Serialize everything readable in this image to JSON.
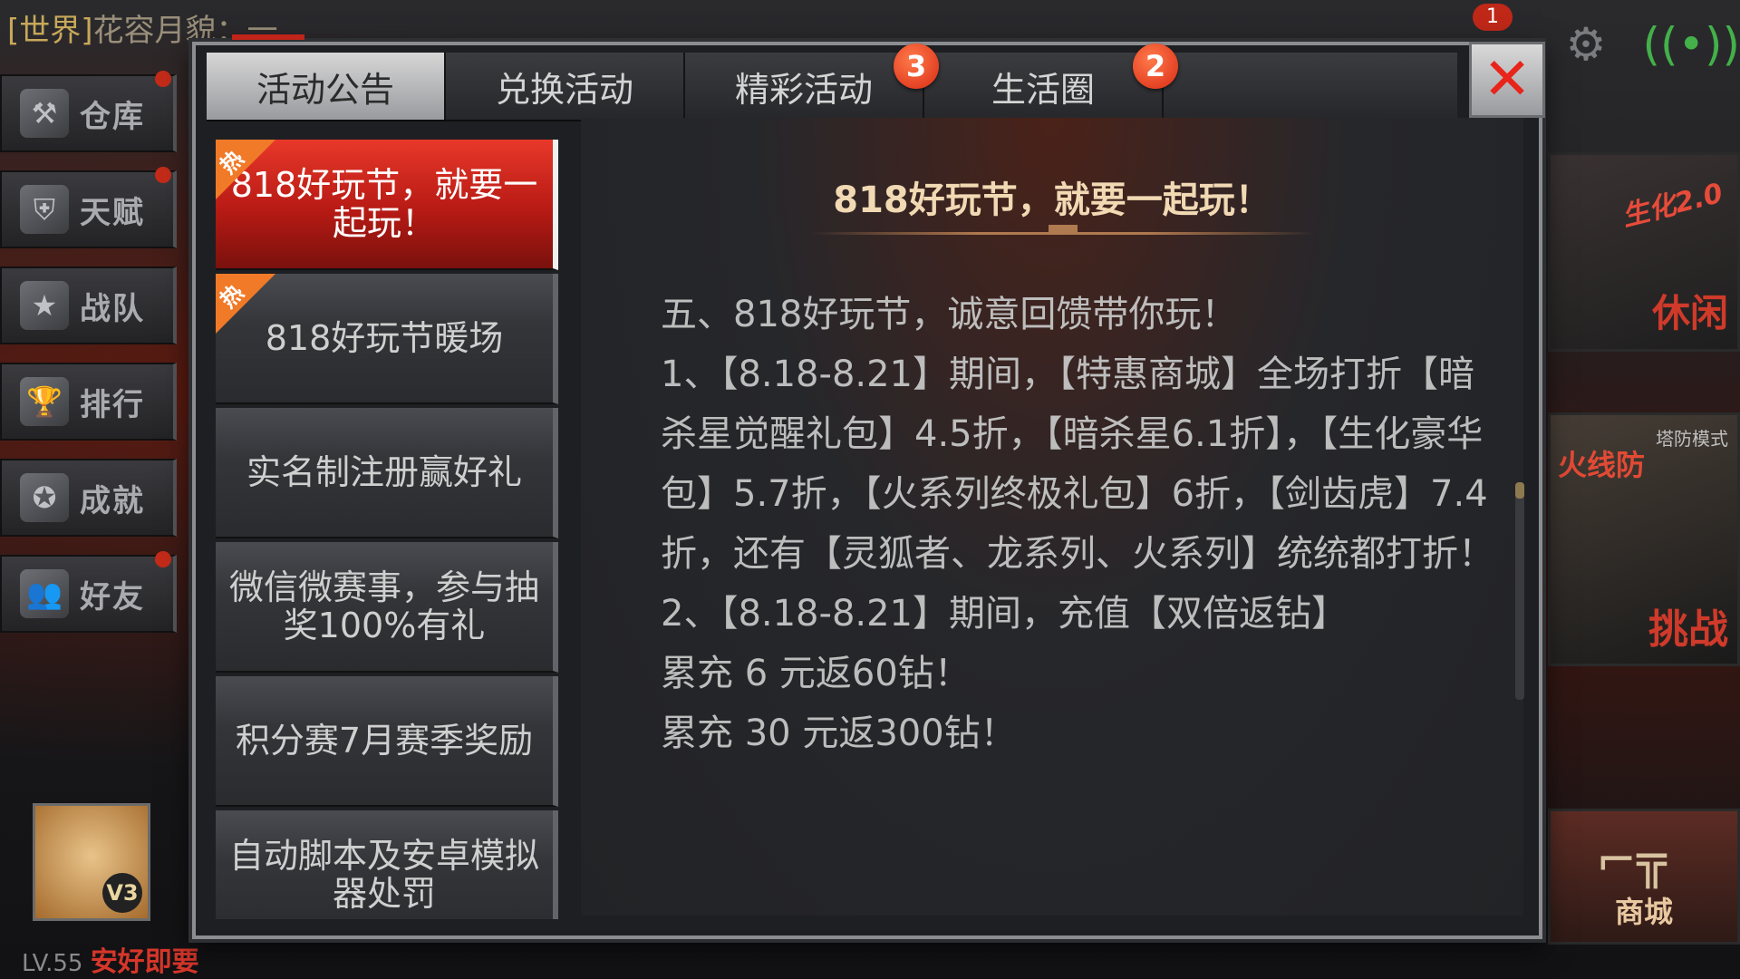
{
  "background": {
    "world_chat": {
      "tag": "[世界]",
      "text": "花容月貌：一"
    },
    "left_sidebar": [
      {
        "label": "仓库",
        "icon": "warehouse-icon"
      },
      {
        "label": "天赋",
        "icon": "talent-icon"
      },
      {
        "label": "战队",
        "icon": "team-icon"
      },
      {
        "label": "排行",
        "icon": "trophy-icon"
      },
      {
        "label": "成就",
        "icon": "medal-icon"
      },
      {
        "label": "好友",
        "icon": "friends-icon"
      }
    ],
    "player": {
      "level": "LV.55",
      "name": "安好即要",
      "vip": "V3"
    },
    "right_panels": {
      "panel1_tag": "生化2.0",
      "panel1_label": "休闲",
      "panel2_top": "塔防模式",
      "panel2_mid": "火线防",
      "panel2_label": "挑战",
      "shop_label": "商城"
    },
    "mail_count": "1"
  },
  "dialog": {
    "tabs": [
      {
        "label": "活动公告",
        "badge": ""
      },
      {
        "label": "兑换活动",
        "badge": ""
      },
      {
        "label": "精彩活动",
        "badge": "3"
      },
      {
        "label": "生活圈",
        "badge": "2"
      },
      {
        "label": "",
        "badge": ""
      }
    ],
    "active_tab_index": 0,
    "hot_label": "热",
    "list": [
      {
        "title": "818好玩节，就要一起玩！",
        "hot": true,
        "active": true
      },
      {
        "title": "818好玩节暖场",
        "hot": true,
        "active": false
      },
      {
        "title": "实名制注册赢好礼",
        "hot": false,
        "active": false
      },
      {
        "title": "微信微赛事，参与抽奖100%有礼",
        "hot": false,
        "active": false
      },
      {
        "title": "积分赛7月赛季奖励",
        "hot": false,
        "active": false
      },
      {
        "title": "自动脚本及安卓模拟器处罚",
        "hot": false,
        "active": false
      }
    ],
    "content": {
      "title": "818好玩节，就要一起玩！",
      "paragraphs": [
        "五、818好玩节，诚意回馈带你玩！",
        "1、【8.18-8.21】期间，【特惠商城】全场打折【暗杀星觉醒礼包】4.5折，【暗杀星6.1折】，【生化豪华包】5.7折，【火系列终极礼包】6折，【剑齿虎】7.4折，还有【灵狐者、龙系列、火系列】统统都打折！",
        "2、【8.18-8.21】期间，充值【双倍返钻】",
        "累充 6  元返60钻！",
        "累充 30 元返300钻！"
      ]
    },
    "accent_color": "#d92b14"
  }
}
